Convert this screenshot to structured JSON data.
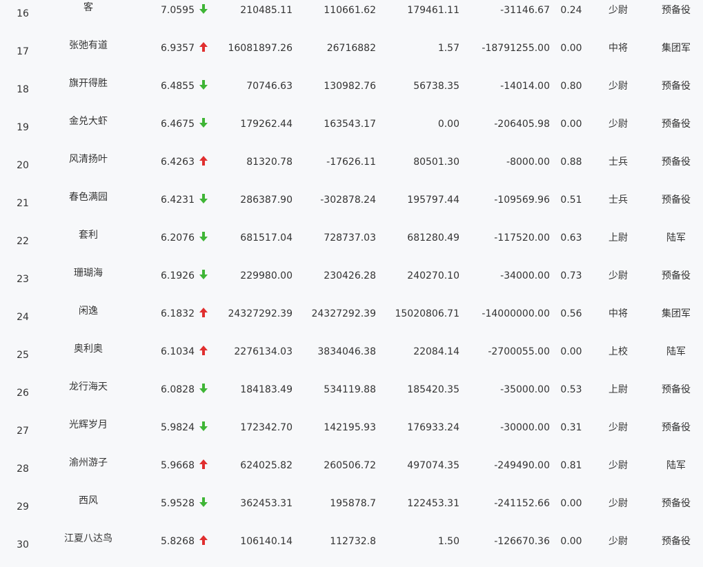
{
  "colors": {
    "up": "#e02f2f",
    "down": "#3fb536",
    "text": "#333333",
    "background": "#f7f8fa"
  },
  "rows": [
    {
      "rank": "16",
      "name": "客",
      "score": "7.0595",
      "trend": "down",
      "v1": "210485.11",
      "v2": "110661.62",
      "v3": "179461.11",
      "v4": "-31146.67",
      "ratio": "0.24",
      "rank_title": "少尉",
      "corps": "预备役"
    },
    {
      "rank": "17",
      "name": "张弛有道",
      "score": "6.9357",
      "trend": "up",
      "v1": "16081897.26",
      "v2": "26716882",
      "v3": "1.57",
      "v4": "-18791255.00",
      "ratio": "0.00",
      "rank_title": "中将",
      "corps": "集团军"
    },
    {
      "rank": "18",
      "name": "旗开得胜",
      "score": "6.4855",
      "trend": "down",
      "v1": "70746.63",
      "v2": "130982.76",
      "v3": "56738.35",
      "v4": "-14014.00",
      "ratio": "0.80",
      "rank_title": "少尉",
      "corps": "预备役"
    },
    {
      "rank": "19",
      "name": "金兑大虾",
      "score": "6.4675",
      "trend": "down",
      "v1": "179262.44",
      "v2": "163543.17",
      "v3": "0.00",
      "v4": "-206405.98",
      "ratio": "0.00",
      "rank_title": "少尉",
      "corps": "预备役"
    },
    {
      "rank": "20",
      "name": "风清扬叶",
      "score": "6.4263",
      "trend": "up",
      "v1": "81320.78",
      "v2": "-17626.11",
      "v3": "80501.30",
      "v4": "-8000.00",
      "ratio": "0.88",
      "rank_title": "士兵",
      "corps": "预备役"
    },
    {
      "rank": "21",
      "name": "春色满园",
      "score": "6.4231",
      "trend": "down",
      "v1": "286387.90",
      "v2": "-302878.24",
      "v3": "195797.44",
      "v4": "-109569.96",
      "ratio": "0.51",
      "rank_title": "士兵",
      "corps": "预备役"
    },
    {
      "rank": "22",
      "name": "套利",
      "score": "6.2076",
      "trend": "down",
      "v1": "681517.04",
      "v2": "728737.03",
      "v3": "681280.49",
      "v4": "-117520.00",
      "ratio": "0.63",
      "rank_title": "上尉",
      "corps": "陆军"
    },
    {
      "rank": "23",
      "name": "珊瑚海",
      "score": "6.1926",
      "trend": "down",
      "v1": "229980.00",
      "v2": "230426.28",
      "v3": "240270.10",
      "v4": "-34000.00",
      "ratio": "0.73",
      "rank_title": "少尉",
      "corps": "预备役"
    },
    {
      "rank": "24",
      "name": "闲逸",
      "score": "6.1832",
      "trend": "up",
      "v1": "24327292.39",
      "v2": "24327292.39",
      "v3": "15020806.71",
      "v4": "-14000000.00",
      "ratio": "0.56",
      "rank_title": "中将",
      "corps": "集团军"
    },
    {
      "rank": "25",
      "name": "奥利奥",
      "score": "6.1034",
      "trend": "up",
      "v1": "2276134.03",
      "v2": "3834046.38",
      "v3": "22084.14",
      "v4": "-2700055.00",
      "ratio": "0.00",
      "rank_title": "上校",
      "corps": "陆军"
    },
    {
      "rank": "26",
      "name": "龙行海天",
      "score": "6.0828",
      "trend": "down",
      "v1": "184183.49",
      "v2": "534119.88",
      "v3": "185420.35",
      "v4": "-35000.00",
      "ratio": "0.53",
      "rank_title": "上尉",
      "corps": "预备役"
    },
    {
      "rank": "27",
      "name": "光辉岁月",
      "score": "5.9824",
      "trend": "down",
      "v1": "172342.70",
      "v2": "142195.93",
      "v3": "176933.24",
      "v4": "-30000.00",
      "ratio": "0.31",
      "rank_title": "少尉",
      "corps": "预备役"
    },
    {
      "rank": "28",
      "name": "渝州游子",
      "score": "5.9668",
      "trend": "up",
      "v1": "624025.82",
      "v2": "260506.72",
      "v3": "497074.35",
      "v4": "-249490.00",
      "ratio": "0.81",
      "rank_title": "少尉",
      "corps": "陆军"
    },
    {
      "rank": "29",
      "name": "西风",
      "score": "5.9528",
      "trend": "down",
      "v1": "362453.31",
      "v2": "195878.7",
      "v3": "122453.31",
      "v4": "-241152.66",
      "ratio": "0.00",
      "rank_title": "少尉",
      "corps": "预备役"
    },
    {
      "rank": "30",
      "name": "江夏八达鸟",
      "score": "5.8268",
      "trend": "up",
      "v1": "106140.14",
      "v2": "112732.8",
      "v3": "1.50",
      "v4": "-126670.36",
      "ratio": "0.00",
      "rank_title": "少尉",
      "corps": "预备役"
    }
  ]
}
